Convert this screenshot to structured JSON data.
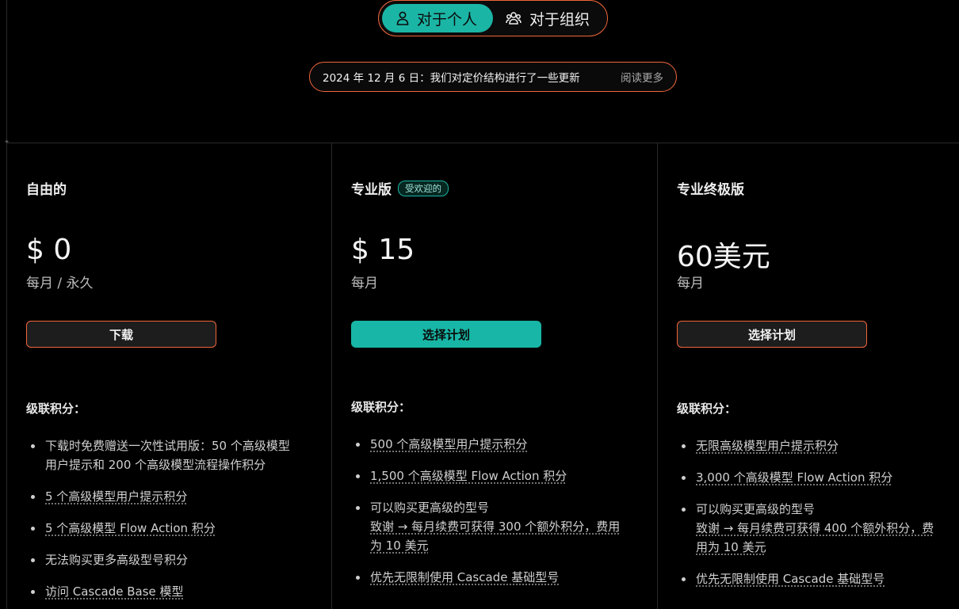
{
  "toggle": {
    "personal_label": "对于个人",
    "org_label": "对于组织"
  },
  "announcement": {
    "text": "2024 年 12 月 6 日：我们对定价结构进行了一些更新",
    "link": "阅读更多"
  },
  "plans": [
    {
      "name": "自由的",
      "price": "$ 0",
      "period": "每月 / 永久",
      "button": "下载",
      "credits_label": "级联积分：",
      "features": [
        [
          "下载时免费赠送一次性试用版：50 个高级模型",
          "用户提示和 200 个高级模型流程操作积分"
        ],
        [
          "5 个高级模型用户提示积分"
        ],
        [
          "5 个高级模型 Flow Action 积分"
        ],
        [
          "无法购买更多高级型号积分"
        ],
        [
          "访问 Cascade Base 模型"
        ]
      ]
    },
    {
      "name": "专业版",
      "badge": "受欢迎的",
      "price": "$ 15",
      "period": "每月",
      "button": "选择计划",
      "credits_label": "级联积分：",
      "features": [
        [
          "500 个高级模型用户提示积分"
        ],
        [
          "1,500 个高级模型 Flow Action 积分"
        ],
        [
          "可以购买更高级的型号",
          "致谢 → 每月续费可获得 300 个额外积分，费用",
          "为 10 美元"
        ],
        [
          "优先无限制使用 Cascade 基础型号"
        ]
      ]
    },
    {
      "name": "专业终极版",
      "price": "60美元",
      "period": "每月",
      "button": "选择计划",
      "credits_label": "级联积分：",
      "features": [
        [
          "无限高级模型用户提示积分"
        ],
        [
          "3,000 个高级模型 Flow Action 积分"
        ],
        [
          "可以购买更高级的型号",
          "致谢 → 每月续费可获得 400 个额外积分，费",
          "用为 10 美元"
        ],
        [
          "优先无限制使用 Cascade 基础型号"
        ]
      ]
    }
  ],
  "colors": {
    "accent_orange": "#f0663a",
    "accent_teal": "#1bb5a5",
    "background": "#000000"
  }
}
